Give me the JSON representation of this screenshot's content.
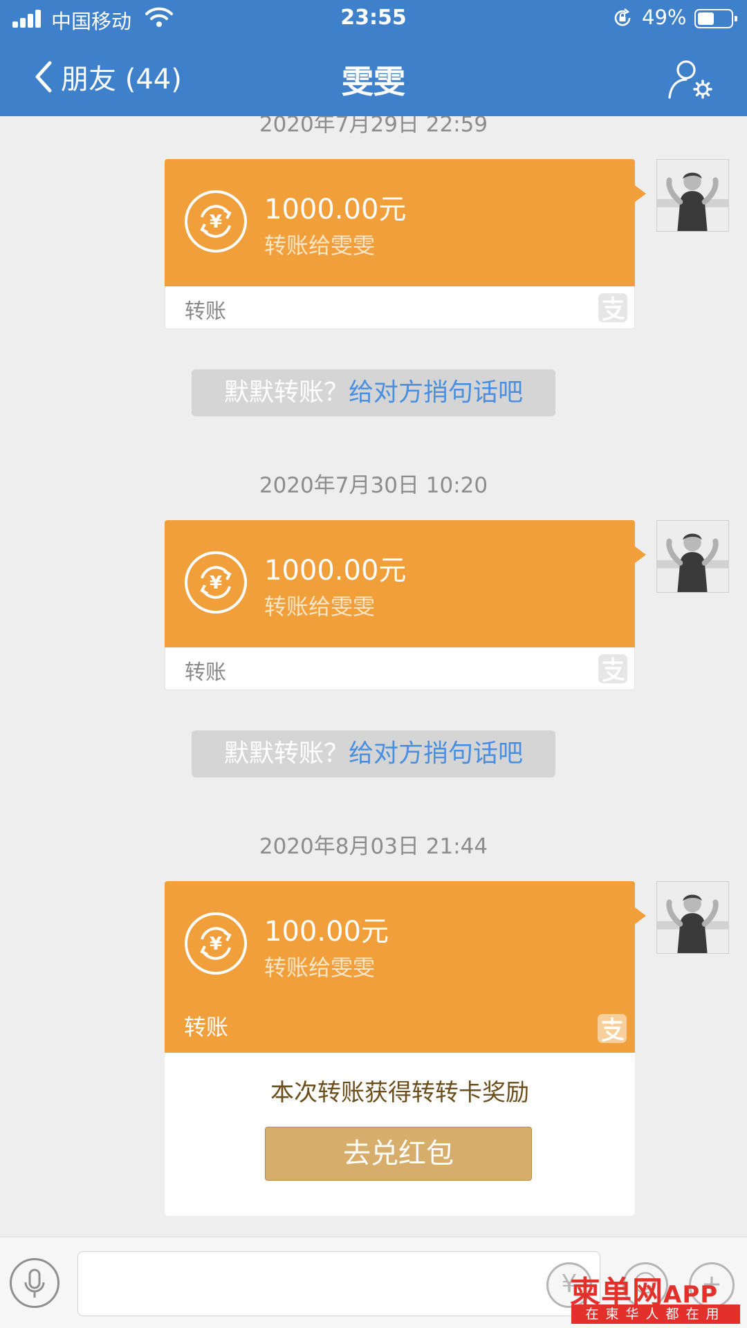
{
  "status_bar": {
    "carrier": "中国移动",
    "time": "23:55",
    "battery_percent_label": "49%",
    "battery_level": 0.49
  },
  "nav": {
    "back_label": "朋友 (44)",
    "title": "雯雯"
  },
  "messages": [
    {
      "timestamp": "2020年7月29日 22:59",
      "amount": "1000.00元",
      "subtitle": "转账给雯雯",
      "footer_label": "转账"
    },
    {
      "hint_prefix": "默默转账？",
      "hint_link": "给对方捎句话吧"
    },
    {
      "timestamp": "2020年7月30日 10:20",
      "amount": "1000.00元",
      "subtitle": "转账给雯雯",
      "footer_label": "转账"
    },
    {
      "hint_prefix": "默默转账？",
      "hint_link": "给对方捎句话吧"
    },
    {
      "timestamp": "2020年8月03日 21:44",
      "amount": "100.00元",
      "subtitle": "转账给雯雯",
      "footer_label": "转账",
      "reward_text": "本次转账获得转转卡奖励",
      "reward_button": "去兑红包"
    }
  ],
  "input_bar": {
    "placeholder": ""
  },
  "watermark": {
    "brand": "柬单网",
    "brand_suffix": "APP",
    "slogan": "在柬华人都在用"
  },
  "icons": {
    "signal": "signal-icon",
    "wifi": "wifi-icon",
    "orientation_lock": "orientation-lock-icon",
    "battery": "battery-icon",
    "back": "chevron-left-icon",
    "profile_settings": "user-settings-icon",
    "transfer_coin": "yuan-transfer-icon",
    "alipay": "alipay-logo-icon",
    "voice": "microphone-icon"
  },
  "colors": {
    "header_blue": "#3f80cb",
    "transfer_orange": "#f09f3b",
    "link_blue": "#4a8fdf",
    "reward_gold": "#d6ad6a",
    "watermark_red": "#e3302a"
  }
}
